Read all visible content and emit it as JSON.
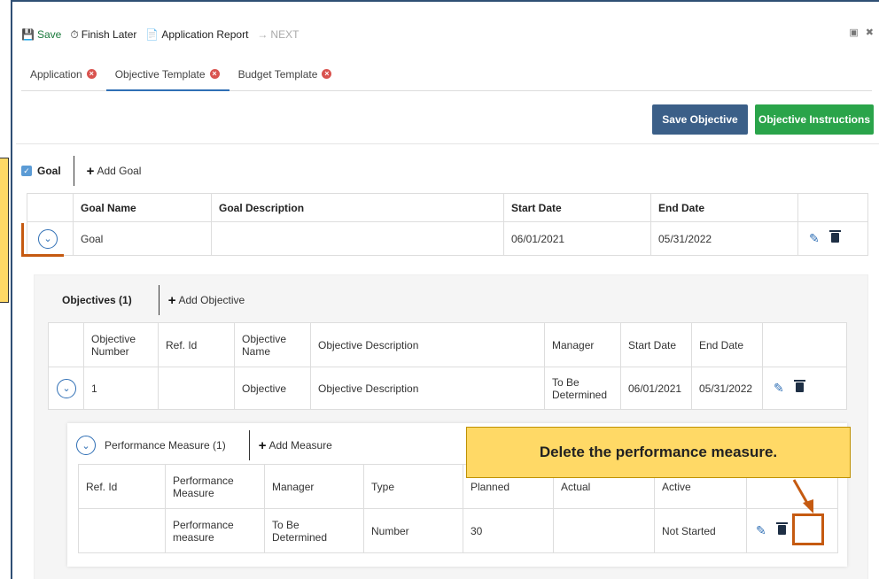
{
  "toolbar": {
    "save": "Save",
    "finish_later": "Finish Later",
    "application_report": "Application Report",
    "next": "NEXT"
  },
  "tabs": [
    {
      "label": "Application"
    },
    {
      "label": "Objective Template"
    },
    {
      "label": "Budget Template"
    }
  ],
  "buttons": {
    "save_objective": "Save Objective",
    "objective_instructions": "Objective Instructions"
  },
  "goal_section": {
    "checkbox_label": "Goal",
    "add_label": "Add Goal",
    "columns": [
      "Goal Name",
      "Goal Description",
      "Start Date",
      "End Date"
    ],
    "row": {
      "name": "Goal",
      "description": "",
      "start": "06/01/2021",
      "end": "05/31/2022"
    }
  },
  "objectives_section": {
    "title": "Objectives (1)",
    "add_label": "Add Objective",
    "columns": [
      "Objective Number",
      "Ref. Id",
      "Objective Name",
      "Objective Description",
      "Manager",
      "Start Date",
      "End Date"
    ],
    "row": {
      "number": "1",
      "ref_id": "",
      "name": "Objective",
      "description": "Objective Description",
      "manager": "To Be Determined",
      "start": "06/01/2021",
      "end": "05/31/2022"
    }
  },
  "measures_section": {
    "title": "Performance Measure (1)",
    "add_label": "Add Measure",
    "columns": [
      "Ref. Id",
      "Performance Measure",
      "Manager",
      "Type",
      "Planned",
      "Actual",
      "Active"
    ],
    "row": {
      "ref_id": "",
      "measure": "Performance measure",
      "manager": "To Be Determined",
      "type": "Number",
      "planned": "30",
      "actual": "",
      "active": "Not Started"
    }
  },
  "callout": {
    "text": "Delete the performance measure."
  },
  "colors": {
    "primary": "#3b5f88",
    "success": "#2aa44a",
    "callout": "#ffd966",
    "highlight": "#c55a11"
  }
}
